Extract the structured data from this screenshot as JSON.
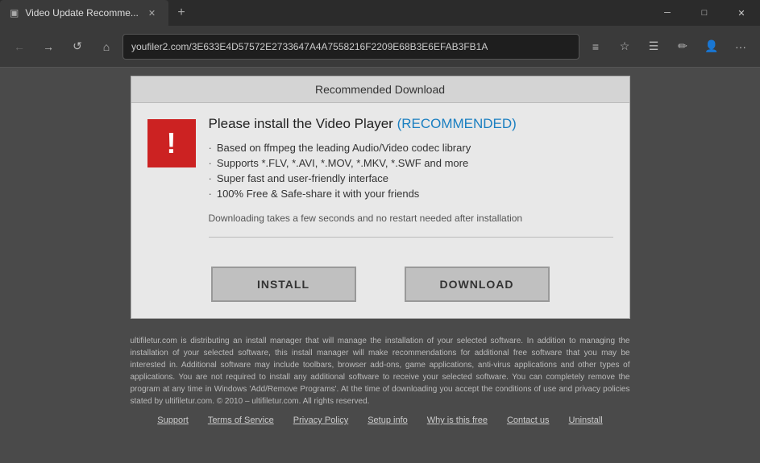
{
  "titlebar": {
    "tab_title": "Video Update Recomme...",
    "tab_icon": "▣",
    "new_tab_icon": "+",
    "minimize_icon": "─",
    "maximize_icon": "□",
    "close_icon": "✕"
  },
  "navbar": {
    "back_icon": "←",
    "forward_icon": "→",
    "refresh_icon": "↺",
    "home_icon": "⌂",
    "address": "youfiler2.com/3E633E4D57572E2733647A4A7558216F2209E68B3E6EFAB3FB1A",
    "reader_icon": "≡",
    "star_icon": "☆",
    "hub_icon": "☰",
    "notes_icon": "✏",
    "account_icon": "👤",
    "more_icon": "···"
  },
  "modal": {
    "header": "Recommended Download",
    "warning_icon": "!",
    "title_plain": "Please install the Video Player ",
    "title_recommended": "(RECOMMENDED)",
    "features": [
      "Based on ffmpeg the leading Audio/Video codec library",
      "Supports *.FLV, *.AVI, *.MOV, *.MKV, *.SWF and more",
      "Super fast and user-friendly interface",
      "100% Free & Safe-share it with your friends"
    ],
    "subtitle": "Downloading takes a few seconds and no restart needed after installation",
    "install_btn": "INSTALL",
    "download_btn": "DOWNLOAD"
  },
  "footer": {
    "disclaimer": "ultifiletur.com is distributing an install manager that will manage the installation of your selected software. In addition to managing the installation of your selected software, this install manager will make recommendations for additional free software that you may be interested in. Additional software may include toolbars, browser add-ons, game applications, anti-virus applications and other types of applications. You are not required to install any additional software to receive your selected software. You can completely remove the program at any time in Windows 'Add/Remove Programs'. At the time of downloading you accept the conditions of use and privacy policies stated by ultifiletur.com. © 2010 – ultifiletur.com. All rights reserved.",
    "links": [
      "Support",
      "Terms of Service",
      "Privacy Policy",
      "Setup info",
      "Why is this free",
      "Contact us",
      "Uninstall"
    ]
  }
}
